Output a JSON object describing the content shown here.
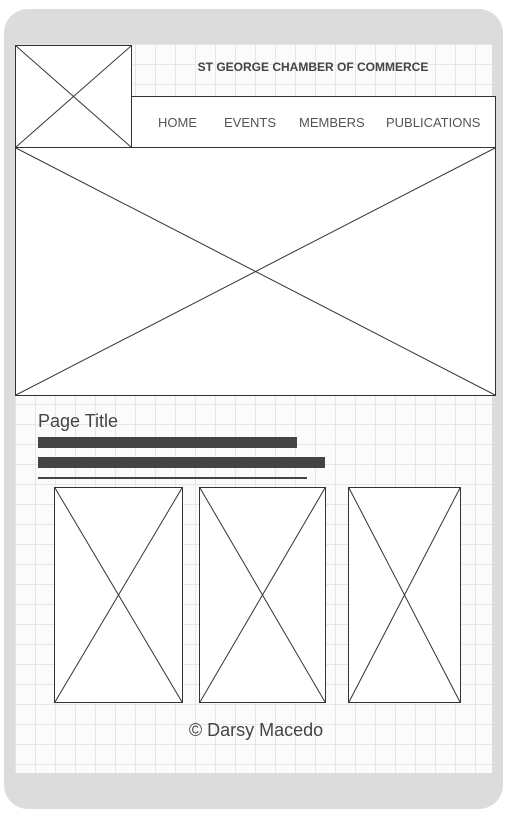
{
  "header": {
    "logo_icon": "image-placeholder-icon",
    "site_title": "ST GEORGE CHAMBER OF COMMERCE"
  },
  "nav": {
    "items": [
      {
        "label": "HOME"
      },
      {
        "label": "EVENTS"
      },
      {
        "label": "MEMBERS"
      },
      {
        "label": "PUBLICATIONS"
      }
    ]
  },
  "hero": {
    "icon": "image-placeholder-icon"
  },
  "content": {
    "page_title": "Page Title",
    "text_lines": 2
  },
  "gallery": {
    "count": 3,
    "icon": "image-placeholder-icon"
  },
  "footer": {
    "copyright": "© Darsy Macedo"
  },
  "colors": {
    "device_frame": "#dcdcdc",
    "line": "#333333",
    "text": "#444444",
    "grid": "#e6e6e6"
  }
}
